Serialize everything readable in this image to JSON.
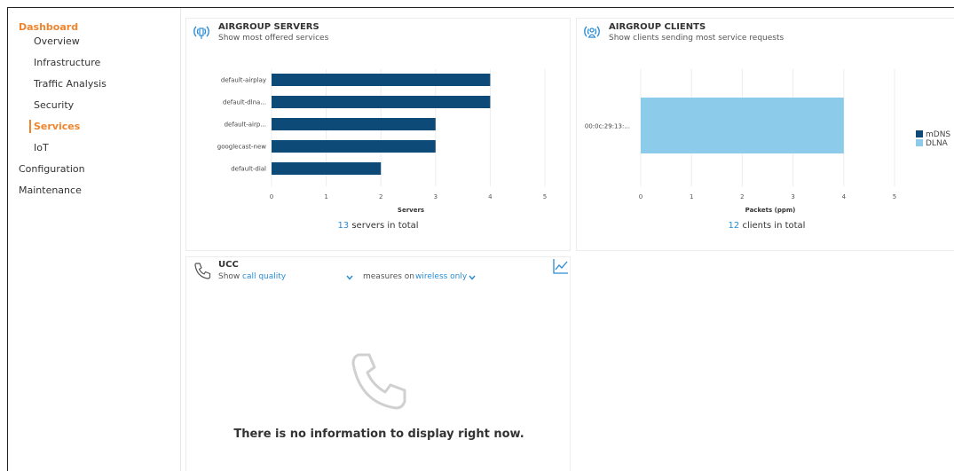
{
  "sidebar": {
    "items": [
      {
        "label": "Dashboard"
      },
      {
        "label": "Overview"
      },
      {
        "label": "Infrastructure"
      },
      {
        "label": "Traffic Analysis"
      },
      {
        "label": "Security"
      },
      {
        "label": "Services"
      },
      {
        "label": "IoT"
      },
      {
        "label": "Configuration"
      },
      {
        "label": "Maintenance"
      }
    ]
  },
  "colors": {
    "accent": "#f0852d",
    "link": "#2a8dd4",
    "bar_dark": "#0e4a78",
    "bar_light": "#8ccbe9"
  },
  "servers_panel": {
    "title": "AIRGROUP SERVERS",
    "subtitle": "Show most offered services",
    "total_count": "13",
    "total_suffix": " servers in total",
    "icon": "airgroup-server-icon"
  },
  "clients_panel": {
    "title": "AIRGROUP CLIENTS",
    "subtitle": "Show clients sending most service requests",
    "total_count": "12",
    "total_suffix": " clients in total",
    "icon": "airgroup-client-icon"
  },
  "ucc_panel": {
    "title": "UCC",
    "show_label": "Show",
    "show_value": "call quality",
    "measures_label": "measures on",
    "measures_value": "wireless only",
    "empty_message": "There is no information to display right now.",
    "icon": "phone-icon"
  },
  "chart_data": [
    {
      "type": "bar",
      "orientation": "horizontal",
      "categories": [
        "default-airplay",
        "default-dlna...",
        "default-airp...",
        "googlecast-new",
        "default-dial"
      ],
      "values": [
        4,
        4,
        3,
        3,
        2
      ],
      "xlabel": "Servers",
      "xlim": [
        0,
        5
      ],
      "ticks": [
        "0",
        "1",
        "2",
        "3",
        "4",
        "5"
      ],
      "grid": true
    },
    {
      "type": "bar",
      "orientation": "horizontal",
      "stacked": true,
      "categories": [
        "00:0c:29:13:..."
      ],
      "series": [
        {
          "name": "mDNS",
          "values": [
            0
          ]
        },
        {
          "name": "DLNA",
          "values": [
            4
          ]
        }
      ],
      "xlabel": "Packets (ppm)",
      "xlim": [
        0,
        5
      ],
      "ticks": [
        "0",
        "1",
        "2",
        "3",
        "4",
        "5"
      ],
      "legend": "right",
      "grid": true
    }
  ]
}
